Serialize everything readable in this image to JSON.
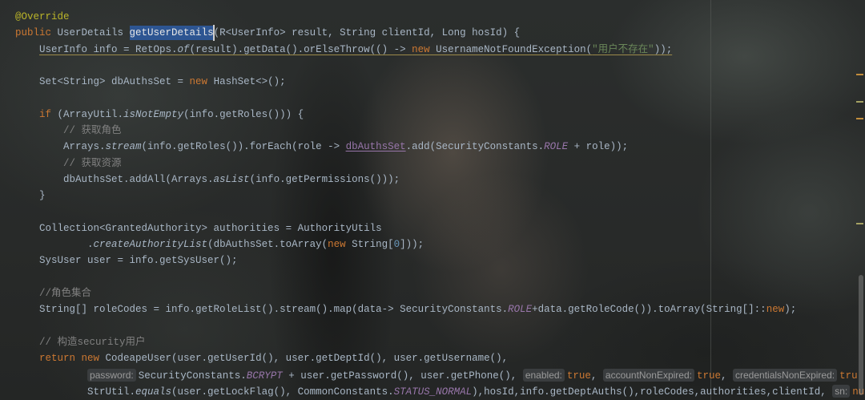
{
  "editor": {
    "colors": {
      "background": "#27292a",
      "text": "#a9b7c6",
      "keyword": "#cc7832",
      "annotation": "#bbb529",
      "string": "#6a8759",
      "comment": "#808080",
      "constant": "#9876aa",
      "number": "#6897bb",
      "method_highlight_bg": "#2d5592",
      "method_highlight_text": "#e6e6e6",
      "caret": "#d0d0d0",
      "warning_underline": "#9c8a4a",
      "hint_text": "#9a9a9a",
      "hint_bg": "#3a3d3f",
      "stripe_warning": "#c28d3c",
      "stripe_weak": "#a5a263"
    },
    "lines": [
      {
        "tokens": [
          {
            "kind": "annotation",
            "text": "@Override"
          }
        ]
      },
      {
        "tokens": [
          {
            "kind": "keyword",
            "text": "public"
          },
          {
            "kind": "plain",
            "text": " UserDetails "
          },
          {
            "kind": "method-decl",
            "text": "getUserDetails",
            "caret": true
          },
          {
            "kind": "plain",
            "text": "(R<UserInfo> result, String clientId, Long hosId) {"
          }
        ]
      },
      {
        "warning": true,
        "tokens": [
          {
            "kind": "indent",
            "text": "    "
          },
          {
            "kind": "plain",
            "text": "UserInfo info = RetOps."
          },
          {
            "kind": "static-call",
            "text": "of"
          },
          {
            "kind": "plain",
            "text": "(result).getData().orElseThrow(() -> "
          },
          {
            "kind": "keyword",
            "text": "new"
          },
          {
            "kind": "plain",
            "text": " UsernameNotFoundException("
          },
          {
            "kind": "string",
            "text": "\"用户不存在\""
          },
          {
            "kind": "plain",
            "text": "));"
          }
        ]
      },
      {
        "tokens": []
      },
      {
        "tokens": [
          {
            "kind": "indent",
            "text": "    "
          },
          {
            "kind": "plain",
            "text": "Set<String> dbAuthsSet = "
          },
          {
            "kind": "keyword",
            "text": "new"
          },
          {
            "kind": "plain",
            "text": " HashSet<>();"
          }
        ]
      },
      {
        "tokens": []
      },
      {
        "tokens": [
          {
            "kind": "indent",
            "text": "    "
          },
          {
            "kind": "keyword",
            "text": "if"
          },
          {
            "kind": "plain",
            "text": " (ArrayUtil."
          },
          {
            "kind": "static-call",
            "text": "isNotEmpty"
          },
          {
            "kind": "plain",
            "text": "(info.getRoles())) {"
          }
        ]
      },
      {
        "tokens": [
          {
            "kind": "indent",
            "text": "        "
          },
          {
            "kind": "comment",
            "text": "// 获取角色"
          }
        ]
      },
      {
        "tokens": [
          {
            "kind": "indent",
            "text": "        "
          },
          {
            "kind": "plain",
            "text": "Arrays."
          },
          {
            "kind": "static-call",
            "text": "stream"
          },
          {
            "kind": "plain",
            "text": "(info.getRoles()).forEach(role -> "
          },
          {
            "kind": "captured",
            "text": "dbAuthsSet"
          },
          {
            "kind": "plain",
            "text": ".add(SecurityConstants."
          },
          {
            "kind": "constant",
            "text": "ROLE"
          },
          {
            "kind": "plain",
            "text": " + role));"
          }
        ]
      },
      {
        "tokens": [
          {
            "kind": "indent",
            "text": "        "
          },
          {
            "kind": "comment",
            "text": "// 获取资源"
          }
        ]
      },
      {
        "tokens": [
          {
            "kind": "indent",
            "text": "        "
          },
          {
            "kind": "plain",
            "text": "dbAuthsSet.addAll(Arrays."
          },
          {
            "kind": "static-call",
            "text": "asList"
          },
          {
            "kind": "plain",
            "text": "(info.getPermissions()));"
          }
        ]
      },
      {
        "tokens": [
          {
            "kind": "indent",
            "text": "    "
          },
          {
            "kind": "plain",
            "text": "}"
          }
        ]
      },
      {
        "tokens": []
      },
      {
        "tokens": [
          {
            "kind": "indent",
            "text": "    "
          },
          {
            "kind": "plain",
            "text": "Collection<GrantedAuthority> authorities = AuthorityUtils"
          }
        ]
      },
      {
        "tokens": [
          {
            "kind": "indent",
            "text": "            "
          },
          {
            "kind": "plain",
            "text": "."
          },
          {
            "kind": "static-call",
            "text": "createAuthorityList"
          },
          {
            "kind": "plain",
            "text": "(dbAuthsSet.toArray("
          },
          {
            "kind": "keyword",
            "text": "new"
          },
          {
            "kind": "plain",
            "text": " String["
          },
          {
            "kind": "number",
            "text": "0"
          },
          {
            "kind": "plain",
            "text": "]));"
          }
        ]
      },
      {
        "tokens": [
          {
            "kind": "indent",
            "text": "    "
          },
          {
            "kind": "plain",
            "text": "SysUser user = info.getSysUser();"
          }
        ]
      },
      {
        "tokens": []
      },
      {
        "tokens": [
          {
            "kind": "indent",
            "text": "    "
          },
          {
            "kind": "comment",
            "text": "//角色集合"
          }
        ]
      },
      {
        "tokens": [
          {
            "kind": "indent",
            "text": "    "
          },
          {
            "kind": "plain",
            "text": "String[] roleCodes = info.getRoleList().stream().map(data-> SecurityConstants."
          },
          {
            "kind": "constant",
            "text": "ROLE"
          },
          {
            "kind": "plain",
            "text": "+data.getRoleCode()).toArray(String[]::"
          },
          {
            "kind": "keyword",
            "text": "new"
          },
          {
            "kind": "plain",
            "text": ");"
          }
        ]
      },
      {
        "tokens": []
      },
      {
        "tokens": [
          {
            "kind": "indent",
            "text": "    "
          },
          {
            "kind": "comment",
            "text": "// 构造security用户"
          }
        ]
      },
      {
        "tokens": [
          {
            "kind": "indent",
            "text": "    "
          },
          {
            "kind": "keyword",
            "text": "return new"
          },
          {
            "kind": "plain",
            "text": " CodeapeUser(user.getUserId(), user.getDeptId(), user.getUsername(),"
          }
        ]
      },
      {
        "tokens": [
          {
            "kind": "indent",
            "text": "            "
          },
          {
            "kind": "hint",
            "text": "password:"
          },
          {
            "kind": "plain",
            "text": "SecurityConstants."
          },
          {
            "kind": "constant",
            "text": "BCRYPT"
          },
          {
            "kind": "plain",
            "text": " + user.getPassword(), user.getPhone(), "
          },
          {
            "kind": "hint",
            "text": "enabled:"
          },
          {
            "kind": "keyword",
            "text": "true"
          },
          {
            "kind": "plain",
            "text": ", "
          },
          {
            "kind": "hint",
            "text": "accountNonExpired:"
          },
          {
            "kind": "keyword",
            "text": "true"
          },
          {
            "kind": "plain",
            "text": ", "
          },
          {
            "kind": "hint",
            "text": "credentialsNonExpired:"
          },
          {
            "kind": "keyword",
            "text": "tru"
          }
        ]
      },
      {
        "tokens": [
          {
            "kind": "indent",
            "text": "            "
          },
          {
            "kind": "plain",
            "text": "StrUtil."
          },
          {
            "kind": "static-call",
            "text": "equals"
          },
          {
            "kind": "plain",
            "text": "(user.getLockFlag(), CommonConstants."
          },
          {
            "kind": "constant",
            "text": "STATUS_NORMAL"
          },
          {
            "kind": "plain",
            "text": "),hosId,info.getDeptAuths(),roleCodes,authorities,clientId, "
          },
          {
            "kind": "hint",
            "text": "sn:"
          },
          {
            "kind": "keyword",
            "text": "nul"
          }
        ]
      }
    ]
  }
}
